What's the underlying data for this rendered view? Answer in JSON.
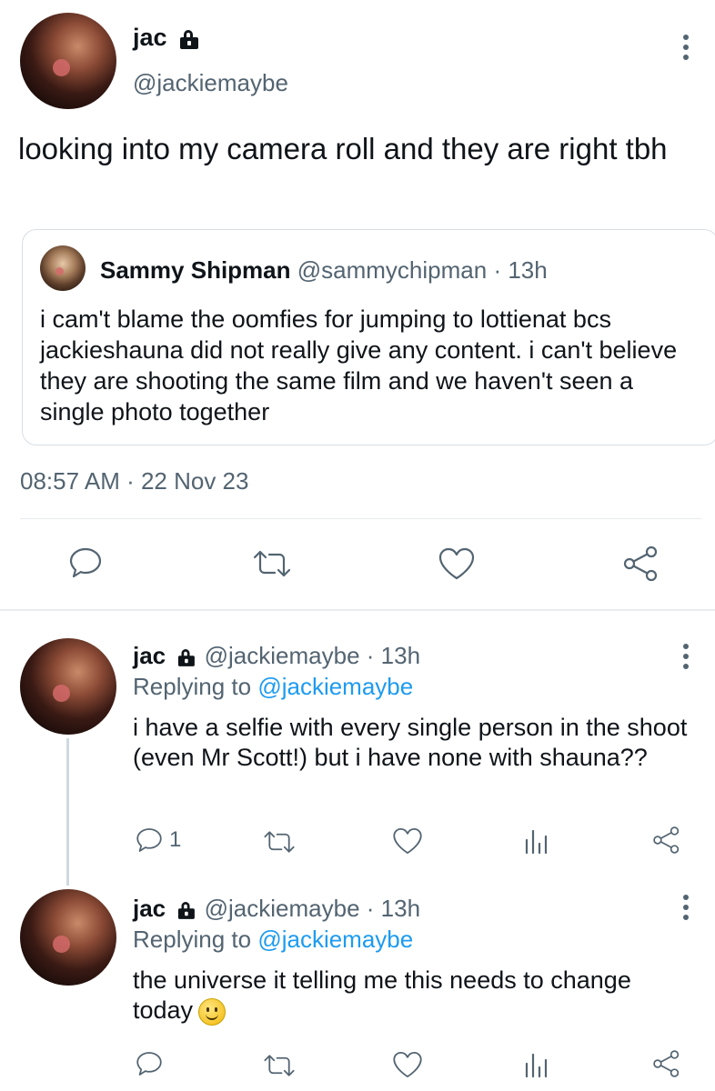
{
  "main_tweet": {
    "display_name": "jac",
    "handle": "@jackiemaybe",
    "text": "looking into my camera roll and they are right tbh",
    "timestamp": "08:57 AM · 22 Nov 23",
    "quoted": {
      "display_name": "Sammy Shipman",
      "handle": "@sammychipman",
      "time": "· 13h",
      "text": "i cam't blame the oomfies for jumping to lottienat bcs jackieshauna did not really give any content. i can't believe they are shooting the same film and we haven't seen a single photo together"
    }
  },
  "replies": [
    {
      "display_name": "jac",
      "handle": "@jackiemaybe",
      "time": "· 13h",
      "replying_prefix": "Replying to",
      "replying_to": "@jackiemaybe",
      "text": "i have a selfie with every single person in the shoot (even Mr Scott!) but i have none with shauna??",
      "reply_count": "1"
    },
    {
      "display_name": "jac",
      "handle": "@jackiemaybe",
      "time": "· 13h",
      "replying_prefix": "Replying to",
      "replying_to": "@jackiemaybe",
      "text": "the universe it telling me this needs to change today",
      "reply_count": ""
    }
  ],
  "icons": [
    "lock-icon",
    "more-icon",
    "reply-icon",
    "retweet-icon",
    "like-icon",
    "share-icon",
    "analytics-icon",
    "smile-emoji-icon"
  ]
}
